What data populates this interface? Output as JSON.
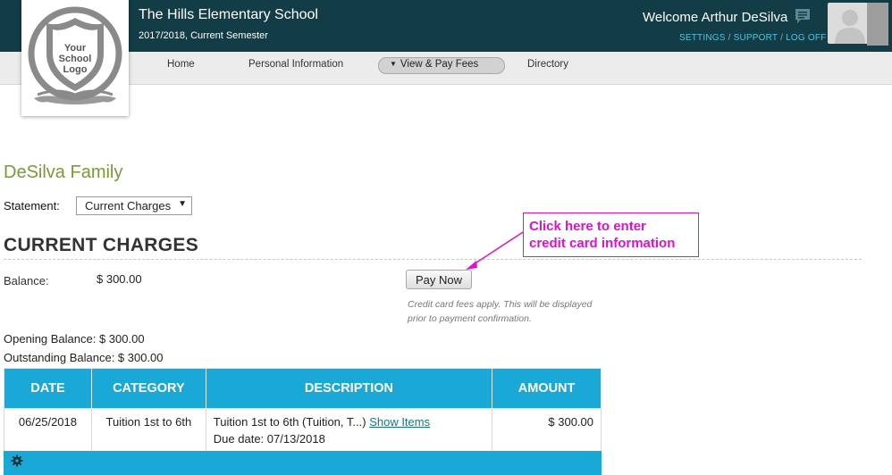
{
  "header": {
    "school_name": "The Hills Elementary School",
    "semester": "2017/2018, Current Semester",
    "welcome": "Welcome Arthur DeSilva",
    "links": [
      "SETTINGS",
      "SUPPORT",
      "LOG OFF"
    ],
    "link_color": "#4fc3e0",
    "bg_color": "#123c46"
  },
  "logo": {
    "lines": [
      "Your",
      "School",
      "Logo"
    ]
  },
  "nav": {
    "items": [
      "Home",
      "Personal Information",
      "View & Pay Fees",
      "Directory"
    ],
    "active": "View & Pay Fees"
  },
  "main": {
    "family": "DeSilva Family",
    "statement_label": "Statement:",
    "statement_value": "Current Charges",
    "section_title": "CURRENT CHARGES",
    "balance_label": "Balance:",
    "balance_value": "$ 300.00",
    "pay_button": "Pay Now",
    "fee_note": "Credit card fees apply. This will be displayed prior to payment confirmation.",
    "opening_balance": "Opening Balance: $ 300.00",
    "outstanding_balance": "Outstanding Balance: $ 300.00"
  },
  "annotation": {
    "text": "Click here to enter\ncredit card information",
    "color": "#e010d0"
  },
  "table": {
    "headers": [
      "DATE",
      "CATEGORY",
      "DESCRIPTION",
      "AMOUNT"
    ],
    "rows": [
      {
        "date": "06/25/2018",
        "category": "Tuition 1st to 6th",
        "description": "Tuition 1st to 6th (Tuition, T...)",
        "link": "Show Items",
        "due": "Due date: 07/13/2018",
        "amount": "$ 300.00"
      }
    ],
    "header_color": "#1aa9d6"
  }
}
